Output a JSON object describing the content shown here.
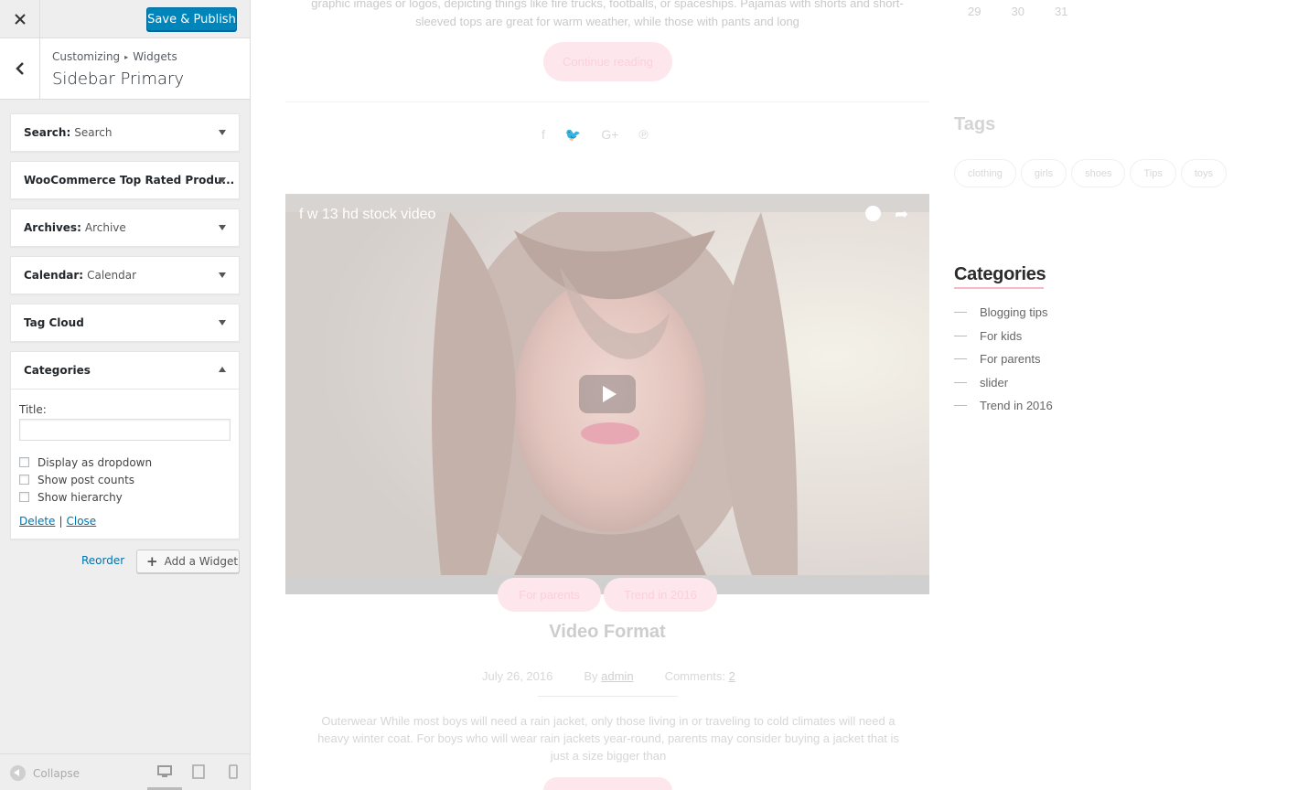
{
  "customizer": {
    "close_label": "×",
    "publish_label": "Save & Publish",
    "breadcrumb": [
      "Customizing",
      "Widgets"
    ],
    "breadcrumb_separator": "▸",
    "section_title": "Sidebar Primary",
    "widgets": [
      {
        "name": "Search:",
        "subtitle": "Search",
        "state": "collapsed"
      },
      {
        "name": "WooCommerce Top Rated Produ...",
        "subtitle": "",
        "state": "collapsed"
      },
      {
        "name": "Archives:",
        "subtitle": "Archive",
        "state": "collapsed"
      },
      {
        "name": "Calendar:",
        "subtitle": "Calendar",
        "state": "collapsed"
      },
      {
        "name": "Tag Cloud",
        "subtitle": "",
        "state": "collapsed"
      },
      {
        "name": "Categories",
        "subtitle": "",
        "state": "expanded"
      }
    ],
    "categories_form": {
      "title_label": "Title:",
      "title_value": "",
      "checkboxes": [
        {
          "label": "Display as dropdown",
          "checked": false
        },
        {
          "label": "Show post counts",
          "checked": false
        },
        {
          "label": "Show hierarchy",
          "checked": false
        }
      ],
      "delete_label": "Delete",
      "separator": "|",
      "close_label": "Close"
    },
    "reorder_label": "Reorder",
    "add_widget_label": "Add a Widget",
    "collapse_label": "Collapse",
    "preview_devices": [
      "desktop-icon",
      "tablet-icon",
      "mobile-icon"
    ],
    "accent_color": "#0085ba",
    "link_color": "#0073aa"
  },
  "preview": {
    "top_excerpt": "graphic images or logos, depicting things like fire trucks, footballs, or spaceships. Pajamas with shorts and short-sleeved tops are great for warm weather, while those with pants and long",
    "continue_label": "Continue reading",
    "share_icons": [
      "facebook-icon",
      "twitter-icon",
      "google-plus-icon",
      "pinterest-icon"
    ],
    "video": {
      "title": "f w 13 hd stock video"
    },
    "post_categories": [
      "For parents",
      "Trend in 2016"
    ],
    "post_title": "Video Format",
    "meta": {
      "date": "July 26, 2016",
      "by_label": "By",
      "author": "admin",
      "comments_label": "Comments:",
      "comments_count": "2"
    },
    "bottom_excerpt": "Outerwear While most boys will need a rain jacket, only those living in or traveling to cold climates will need a heavy winter coat. For boys who will wear rain jackets year-round, parents may consider buying a jacket that is just a size bigger than",
    "calendar_days": [
      "29",
      "30",
      "31"
    ],
    "tags_title": "Tags",
    "tags": [
      "clothing",
      "girls",
      "shoes",
      "Tips",
      "toys"
    ],
    "categories_title": "Categories",
    "categories": [
      "Blogging tips",
      "For kids",
      "For parents",
      "slider",
      "Trend in 2016"
    ],
    "accent_pink": "#f7b9c6"
  }
}
